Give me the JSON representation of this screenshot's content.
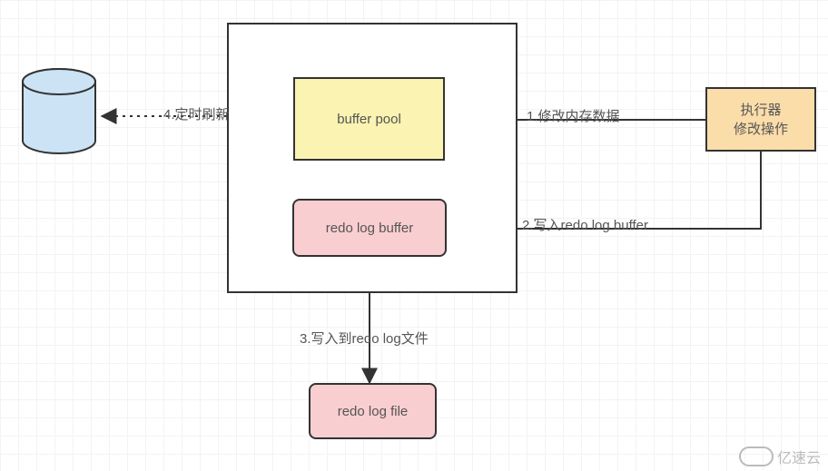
{
  "nodes": {
    "container_label": "",
    "buffer_pool": "buffer pool",
    "redo_log_buffer": "redo log buffer",
    "redo_log_file": "redo log file",
    "executor_line1": "执行器",
    "executor_line2": "修改操作"
  },
  "edges": {
    "e1": "1.修改内存数据",
    "e2": "2.写入redo log buffer",
    "e3": "3.写入到redo log文件",
    "e4": "4.定时刷新"
  },
  "watermark": "亿速云",
  "colors": {
    "buffer_pool_fill": "#FAF3B1",
    "redo_fill": "#F9CED0",
    "executor_fill": "#FBDDAA",
    "database_fill": "#CBE3F4",
    "stroke": "#333333"
  }
}
